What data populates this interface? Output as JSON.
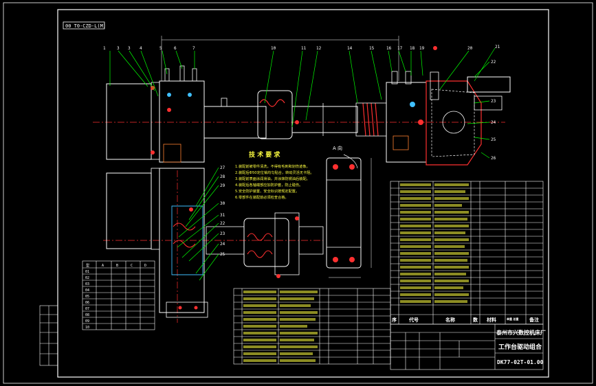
{
  "drawing_number_flag": "00 T0-CZD-L(M)",
  "balloons_top": [
    "1",
    "3",
    "3",
    "4",
    "5",
    "6",
    "7",
    "8",
    "9",
    "10",
    "11",
    "12",
    "13",
    "14",
    "15",
    "16",
    "17",
    "18",
    "19",
    "20",
    "21",
    "22"
  ],
  "balloons_side": [
    "22",
    "23",
    "24",
    "25",
    "26",
    "27",
    "28",
    "29",
    "30",
    "31"
  ],
  "tech_req_title": "技 术 要 求",
  "tech_req_lines": [
    "1.装配前被零件清洗，不得有毛刺和划伤迹象。",
    "2.装配后Ф50定位销均匀贴合，转动灵活无卡阻。",
    "3.装配前表面涂润滑油，并涂抹防锈油后装配。",
    "4.装配后各轴端部应加防护套，防止碰伤。",
    "5.安全防护装置、安全标识按规定配置。",
    "6.零部件在装配前必须检查合格。"
  ],
  "view_label": "A 向",
  "dim_table": {
    "header": [
      "型",
      "A",
      "B",
      "C",
      "D"
    ],
    "rows": [
      [
        "01",
        "",
        "",
        "",
        ""
      ],
      [
        "02",
        "",
        "",
        "",
        ""
      ],
      [
        "03",
        "",
        "",
        "",
        ""
      ],
      [
        "04",
        "",
        "",
        "",
        ""
      ],
      [
        "05",
        "",
        "",
        "",
        ""
      ],
      [
        "06",
        "",
        "",
        "",
        ""
      ],
      [
        "07",
        "",
        "",
        "",
        ""
      ],
      [
        "08",
        "",
        "",
        "",
        ""
      ],
      [
        "09",
        "",
        "",
        "",
        ""
      ],
      [
        "10",
        "",
        "",
        "",
        ""
      ]
    ]
  },
  "bom_headers": [
    "序",
    "代号",
    "名称",
    "数",
    "材料",
    "单重 总重",
    "备注"
  ],
  "title_block": {
    "company": "泰州市兴数控机床厂",
    "title": "工作台驱动组合",
    "number": "DK77-02T-01.00"
  },
  "colors": {
    "background": "#000000",
    "border": "#ffffff",
    "centerline": "#ff3030",
    "leader": "#00ff00",
    "part": "#ffffff",
    "accent_red": "#ff3030",
    "accent_cyan": "#40c0ff",
    "text_yellow": "#ffff40"
  }
}
